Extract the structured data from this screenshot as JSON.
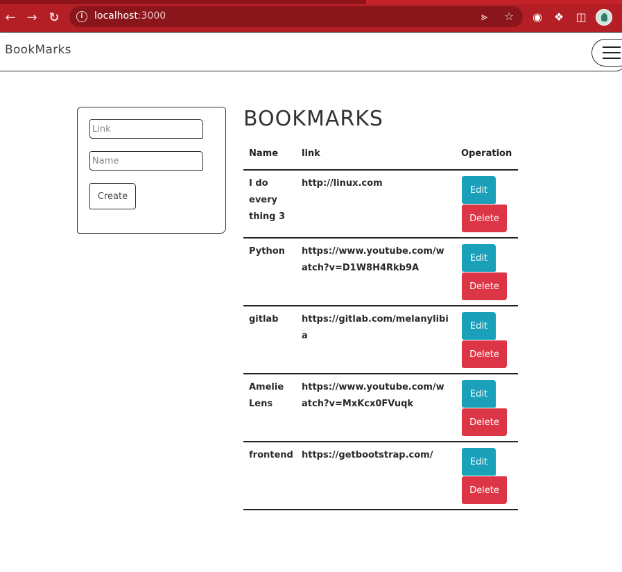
{
  "browser": {
    "url_host": "localhost",
    "url_port": ":3000"
  },
  "navbar": {
    "brand": "BookMarks"
  },
  "form": {
    "link_placeholder": "Link",
    "name_placeholder": "Name",
    "create_label": "Create"
  },
  "main": {
    "heading": "BOOKMARKS",
    "columns": [
      "Name",
      "link",
      "Operation"
    ],
    "rows": [
      {
        "name": "I do every thing 3",
        "link": "http://linux.com",
        "edit": "Edit",
        "delete": "Delete"
      },
      {
        "name": "Python",
        "link": "https://www.youtube.com/watch?v=D1W8H4Rkb9A",
        "edit": "Edit",
        "delete": "Delete"
      },
      {
        "name": "gitlab",
        "link": "https://gitlab.com/melanylibia",
        "edit": "Edit",
        "delete": "Delete"
      },
      {
        "name": "Amelie Lens",
        "link": "https://www.youtube.com/watch?v=MxKcx0FVuqk",
        "edit": "Edit",
        "delete": "Delete"
      },
      {
        "name": "frontend",
        "link": "https://getbootstrap.com/",
        "edit": "Edit",
        "delete": "Delete"
      }
    ]
  },
  "colors": {
    "chrome": "#b31f25",
    "edit": "#1aa0b8",
    "delete": "#dc3545"
  }
}
